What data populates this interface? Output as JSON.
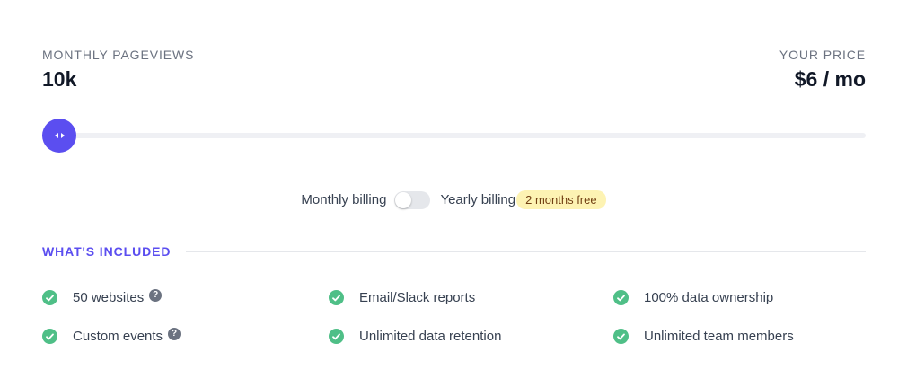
{
  "pageviews": {
    "label": "MONTHLY PAGEVIEWS",
    "value": "10k"
  },
  "price": {
    "label": "YOUR PRICE",
    "value": "$6 / mo"
  },
  "slider": {
    "fraction": 0.0,
    "color": "#5b4ef0"
  },
  "billing": {
    "monthly_label": "Monthly billing",
    "yearly_label": "Yearly billing",
    "badge": "2 months free",
    "yearly_selected": false
  },
  "included": {
    "title": "WHAT'S INCLUDED",
    "features": [
      {
        "label": "50 websites",
        "has_help": true
      },
      {
        "label": "Email/Slack reports",
        "has_help": false
      },
      {
        "label": "100% data ownership",
        "has_help": false
      },
      {
        "label": "Custom events",
        "has_help": true
      },
      {
        "label": "Unlimited data retention",
        "has_help": false
      },
      {
        "label": "Unlimited team members",
        "has_help": false
      }
    ],
    "help_glyph": "?"
  },
  "colors": {
    "accent": "#5b4ef0",
    "check": "#4fbf87",
    "badge_bg": "#fdf3b3"
  }
}
